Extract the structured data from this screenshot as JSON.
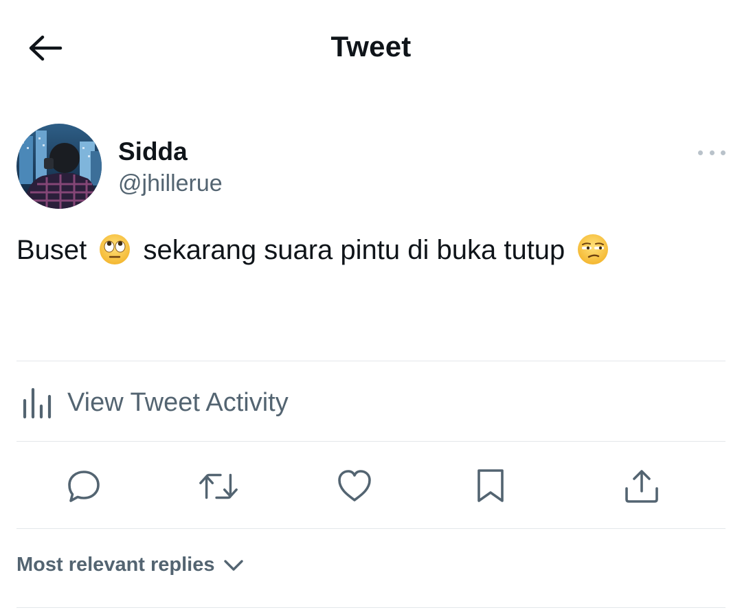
{
  "header": {
    "title": "Tweet",
    "back_icon": "arrow-left-icon"
  },
  "tweet": {
    "author": {
      "name": "Sidda",
      "handle": "@jhillerue"
    },
    "text_parts": [
      "Buset",
      "sekarang suara pintu di buka tutup"
    ],
    "emojis": [
      "face-with-rolling-eyes",
      "unamused-face"
    ]
  },
  "activity": {
    "label": "View Tweet Activity",
    "icon": "bar-chart-icon"
  },
  "actions": [
    "reply-icon",
    "retweet-icon",
    "like-icon",
    "bookmark-icon",
    "share-icon"
  ],
  "replies": {
    "sort_label": "Most relevant replies"
  },
  "colors": {
    "text": "#0f1419",
    "secondary": "#536471",
    "divider": "#e3e7ea"
  }
}
